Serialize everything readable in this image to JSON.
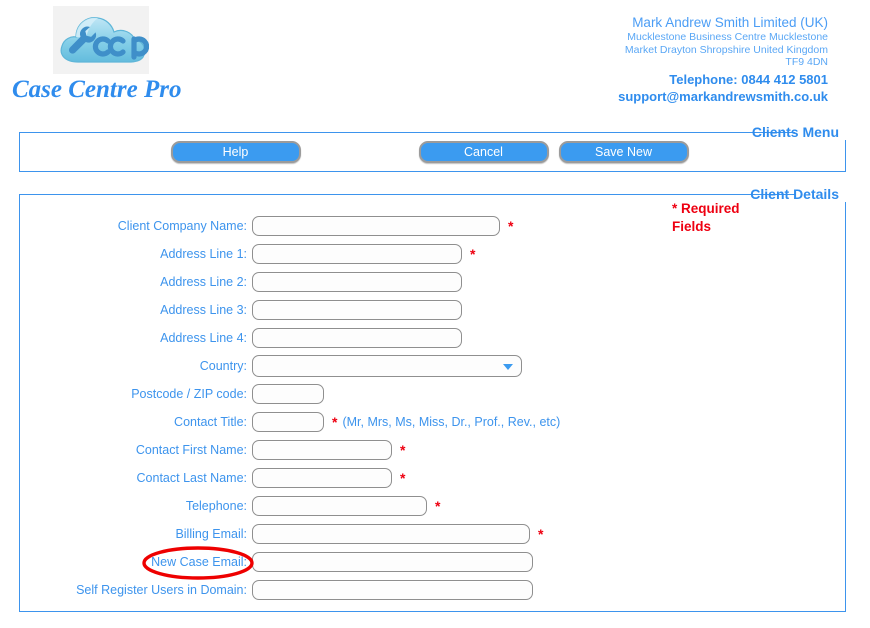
{
  "header": {
    "brand_title": "Case Centre Pro",
    "logo_text": "ccp",
    "company_name": "Mark Andrew Smith Limited (UK)",
    "company_address_line1": "Mucklestone Business Centre Mucklestone",
    "company_address_line2": "Market Drayton Shropshire United Kingdom",
    "company_postcode": "TF9 4DN",
    "company_phone": "Telephone: 0844 412 5801",
    "company_email": "support@markandrewsmith.co.uk"
  },
  "clients_menu": {
    "legend": "Clients Menu",
    "help_label": "Help",
    "cancel_label": "Cancel",
    "save_new_label": "Save New"
  },
  "client_details": {
    "legend": "Client Details",
    "required_note": "* Required Fields",
    "required_marker": "*",
    "contact_title_hint": "(Mr, Mrs, Ms, Miss, Dr., Prof., Rev., etc)",
    "fields": [
      {
        "label": "Client Company Name:",
        "value": "",
        "required": true
      },
      {
        "label": "Address Line 1:",
        "value": "",
        "required": true
      },
      {
        "label": "Address Line 2:",
        "value": "",
        "required": false
      },
      {
        "label": "Address Line 3:",
        "value": "",
        "required": false
      },
      {
        "label": "Address Line 4:",
        "value": "",
        "required": false
      },
      {
        "label": "Country:",
        "value": "",
        "required": false
      },
      {
        "label": "Postcode / ZIP code:",
        "value": "",
        "required": false
      },
      {
        "label": "Contact Title:",
        "value": "",
        "required": true
      },
      {
        "label": "Contact First Name:",
        "value": "",
        "required": true
      },
      {
        "label": "Contact Last Name:",
        "value": "",
        "required": true
      },
      {
        "label": "Telephone:",
        "value": "",
        "required": true
      },
      {
        "label": "Billing Email:",
        "value": "",
        "required": true
      },
      {
        "label": "New Case Email:",
        "value": "",
        "required": false
      },
      {
        "label": "Self Register Users in Domain:",
        "value": "",
        "required": false
      }
    ],
    "country_selected": ""
  },
  "annotation": {
    "highlight_target": "New Case Email:",
    "color": "#ee0000"
  },
  "colors": {
    "accent_blue": "#3d94ed",
    "button_blue": "#3b9bf0",
    "required_red": "#ee0011",
    "annotation_red": "#ee0000"
  }
}
